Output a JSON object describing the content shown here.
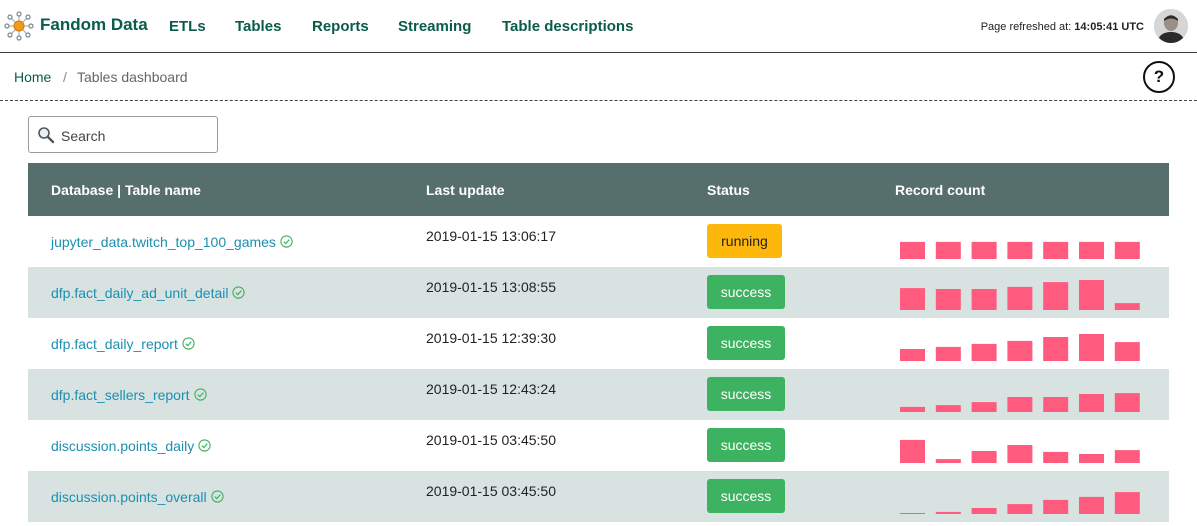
{
  "header": {
    "brand": "Fandom Data",
    "nav": [
      "ETLs",
      "Tables",
      "Reports",
      "Streaming",
      "Table descriptions"
    ],
    "refreshed_label": "Page refreshed at:",
    "refreshed_time": "14:05:41 UTC"
  },
  "breadcrumb": {
    "home": "Home",
    "separator": "/",
    "current": "Tables dashboard"
  },
  "help_label": "?",
  "search": {
    "placeholder": "Search",
    "value": ""
  },
  "table": {
    "columns": [
      "Database | Table name",
      "Last update",
      "Status",
      "Record count"
    ],
    "rows": [
      {
        "name": "jupyter_data.twitch_top_100_games",
        "updated": "2019-01-15 13:06:17",
        "status": "running",
        "counts": [
          0.57,
          0.57,
          0.57,
          0.57,
          0.57,
          0.57,
          0.57
        ]
      },
      {
        "name": "dfp.fact_daily_ad_unit_detail",
        "updated": "2019-01-15 13:08:55",
        "status": "success",
        "counts": [
          0.73,
          0.7,
          0.7,
          0.77,
          0.93,
          1.0,
          0.23
        ]
      },
      {
        "name": "dfp.fact_daily_report",
        "updated": "2019-01-15 12:39:30",
        "status": "success",
        "counts": [
          0.4,
          0.47,
          0.57,
          0.67,
          0.8,
          0.9,
          0.63
        ]
      },
      {
        "name": "dfp.fact_sellers_report",
        "updated": "2019-01-15 12:43:24",
        "status": "success",
        "counts": [
          0.17,
          0.23,
          0.33,
          0.5,
          0.5,
          0.6,
          0.63
        ]
      },
      {
        "name": "discussion.points_daily",
        "updated": "2019-01-15 03:45:50",
        "status": "success",
        "counts": [
          0.77,
          0.13,
          0.4,
          0.6,
          0.37,
          0.3,
          0.43
        ]
      },
      {
        "name": "discussion.points_overall",
        "updated": "2019-01-15 03:45:50",
        "status": "success",
        "counts": [
          0.03,
          0.07,
          0.2,
          0.33,
          0.47,
          0.57,
          0.73
        ]
      }
    ]
  },
  "colors": {
    "brand": "#0a5c4a",
    "header_bg": "#566f6d",
    "alt_row": "#d8e3e1",
    "link": "#1b8fb0",
    "success": "#3db260",
    "running": "#fdb80b",
    "bars": "#ff5b7f",
    "check": "#3db260"
  },
  "icons": {
    "logo": "network-logo-icon",
    "search": "magnifier-icon",
    "check": "check-circle-icon"
  }
}
